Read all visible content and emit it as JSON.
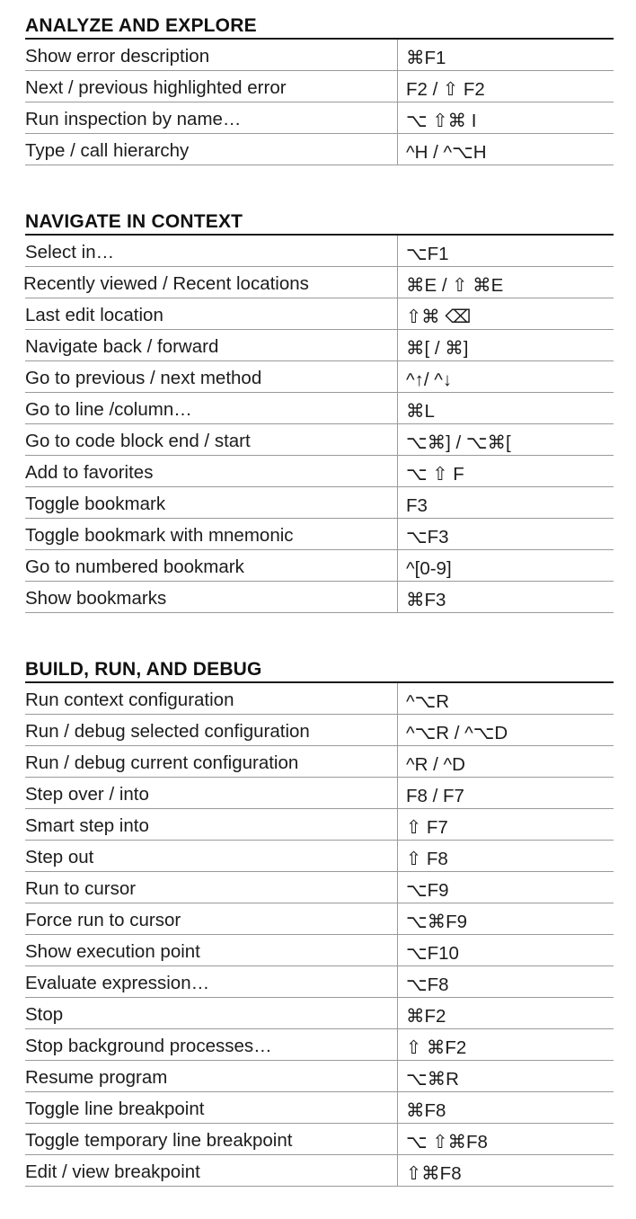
{
  "sections": [
    {
      "title": "ANALYZE AND EXPLORE",
      "rows": [
        {
          "desc": "Show error description",
          "keys": "⌘F1"
        },
        {
          "desc": "Next / previous highlighted error",
          "keys": "F2 / ⇧ F2"
        },
        {
          "desc": "Run inspection by name…",
          "keys": "⌥ ⇧⌘ I"
        },
        {
          "desc": "Type / call hierarchy",
          "keys": "^H / ^⌥H"
        }
      ]
    },
    {
      "title": "NAVIGATE IN CONTEXT",
      "rows": [
        {
          "desc": "Select in…",
          "keys": "⌥F1"
        },
        {
          "desc": "Recently viewed / Recent locations",
          "keys": "⌘E / ⇧ ⌘E"
        },
        {
          "desc": "Last edit location",
          "keys": "⇧⌘ ⌫"
        },
        {
          "desc": "Navigate back / forward",
          "keys": "⌘[ / ⌘]"
        },
        {
          "desc": "Go to previous / next method",
          "keys": "^↑/ ^↓"
        },
        {
          "desc": "Go to line /column…",
          "keys": "⌘L"
        },
        {
          "desc": "Go to code block end / start",
          "keys": "⌥⌘] / ⌥⌘["
        },
        {
          "desc": "Add to favorites",
          "keys": "⌥ ⇧ F"
        },
        {
          "desc": "Toggle bookmark",
          "keys": "F3"
        },
        {
          "desc": "Toggle bookmark with mnemonic",
          "keys": "⌥F3"
        },
        {
          "desc": "Go to numbered bookmark",
          "keys": "^[0-9]"
        },
        {
          "desc": "Show bookmarks",
          "keys": "⌘F3"
        }
      ]
    },
    {
      "title": "BUILD, RUN, AND DEBUG",
      "rows": [
        {
          "desc": "Run context configuration",
          "keys": "^⌥R"
        },
        {
          "desc": "Run / debug selected configuration",
          "keys": "^⌥R / ^⌥D"
        },
        {
          "desc": "Run / debug current configuration",
          "keys": "^R / ^D"
        },
        {
          "desc": "Step over / into",
          "keys": "F8 / F7"
        },
        {
          "desc": "Smart step into",
          "keys": "⇧ F7"
        },
        {
          "desc": "Step out",
          "keys": "⇧ F8"
        },
        {
          "desc": "Run to cursor",
          "keys": "⌥F9"
        },
        {
          "desc": "Force run to cursor",
          "keys": "⌥⌘F9"
        },
        {
          "desc": "Show execution point",
          "keys": "⌥F10"
        },
        {
          "desc": "Evaluate expression…",
          "keys": "⌥F8"
        },
        {
          "desc": "Stop",
          "keys": "⌘F2"
        },
        {
          "desc": "Stop background processes…",
          "keys": "⇧ ⌘F2"
        },
        {
          "desc": "Resume program",
          "keys": "⌥⌘R"
        },
        {
          "desc": "Toggle line breakpoint",
          "keys": "⌘F8"
        },
        {
          "desc": "Toggle temporary line breakpoint",
          "keys": "⌥ ⇧⌘F8"
        },
        {
          "desc": "Edit / view breakpoint",
          "keys": "⇧⌘F8"
        }
      ]
    }
  ]
}
